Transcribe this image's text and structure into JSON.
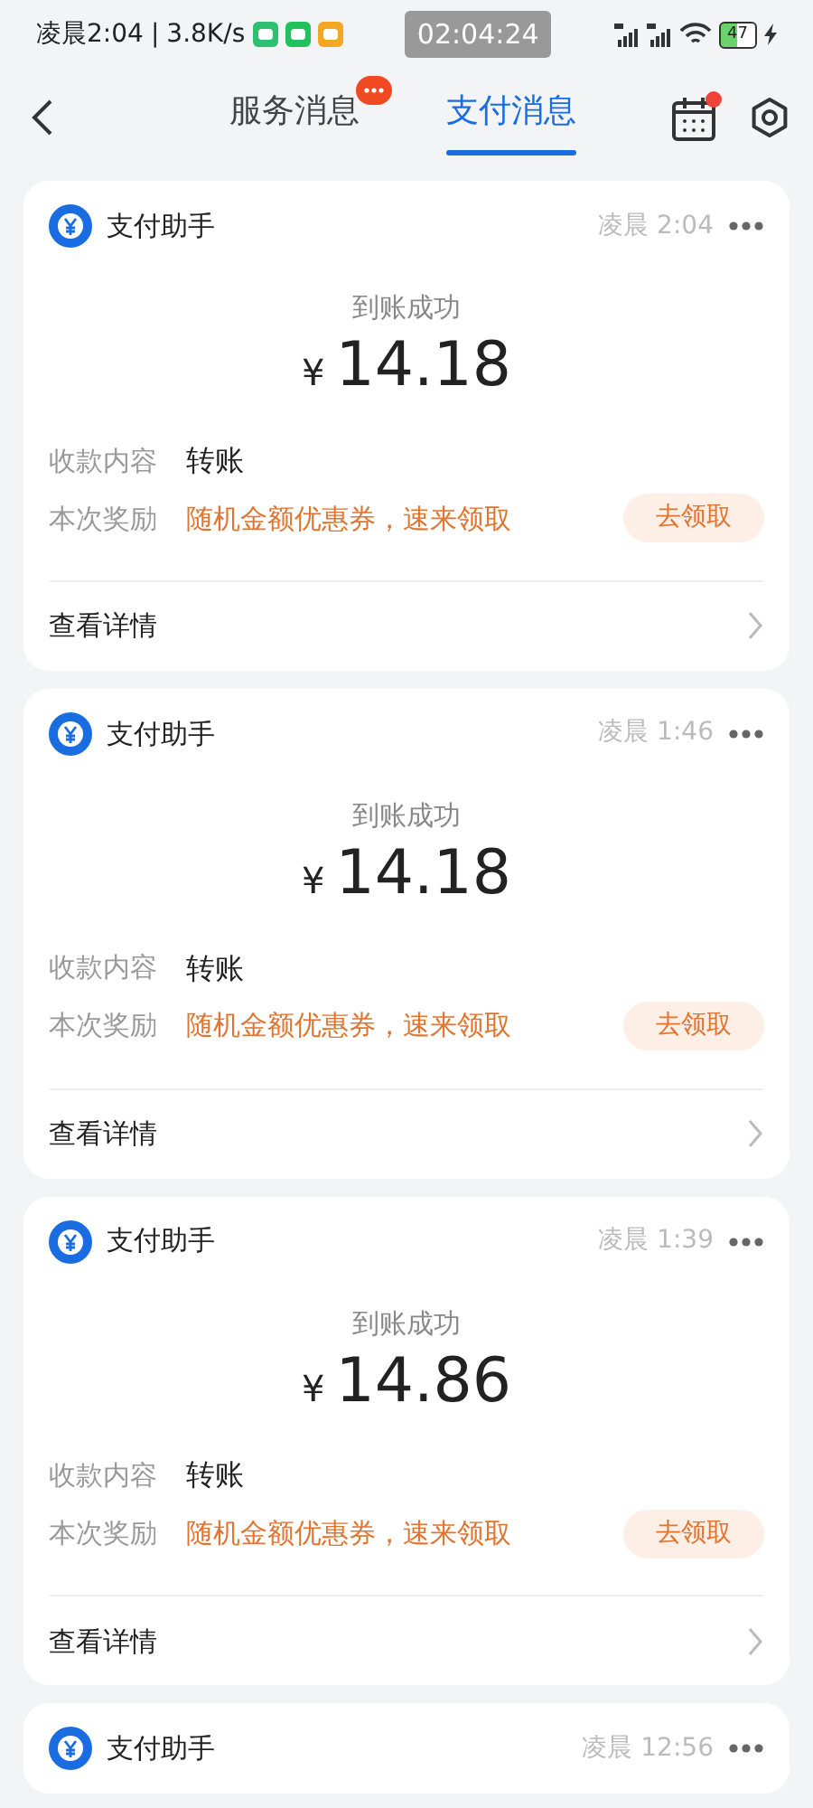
{
  "status_bar": {
    "time": "凌晨2:04",
    "separator": "|",
    "speed": "3.8K/s",
    "clock_overlay": "02:04:24",
    "battery": "47",
    "charging": true
  },
  "tabs": [
    {
      "label": "服务消息",
      "selected": false,
      "badge": true
    },
    {
      "label": "支付消息",
      "selected": true,
      "badge": false
    }
  ],
  "calendar_dot": true,
  "messages": [
    {
      "sender": "支付助手",
      "time": "凌晨 2:04",
      "status": "到账成功",
      "currency": "¥",
      "amount": "14.18",
      "rows": [
        {
          "kind": "info",
          "label": "收款内容",
          "value": "转账"
        },
        {
          "kind": "reward",
          "label": "本次奖励",
          "value": "随机金额优惠券，速来领取",
          "action": "去领取"
        }
      ],
      "details": "查看详情"
    },
    {
      "sender": "支付助手",
      "time": "凌晨 1:46",
      "status": "到账成功",
      "currency": "¥",
      "amount": "14.18",
      "rows": [
        {
          "kind": "info",
          "label": "收款内容",
          "value": "转账"
        },
        {
          "kind": "reward",
          "label": "本次奖励",
          "value": "随机金额优惠券，速来领取",
          "action": "去领取"
        }
      ],
      "details": "查看详情"
    },
    {
      "sender": "支付助手",
      "time": "凌晨 1:39",
      "status": "到账成功",
      "currency": "¥",
      "amount": "14.86",
      "rows": [
        {
          "kind": "info",
          "label": "收款内容",
          "value": "转账"
        },
        {
          "kind": "reward",
          "label": "本次奖励",
          "value": "随机金额优惠券，速来领取",
          "action": "去领取"
        }
      ],
      "details": "查看详情"
    },
    {
      "sender": "支付助手",
      "time": "凌晨 12:56"
    }
  ]
}
